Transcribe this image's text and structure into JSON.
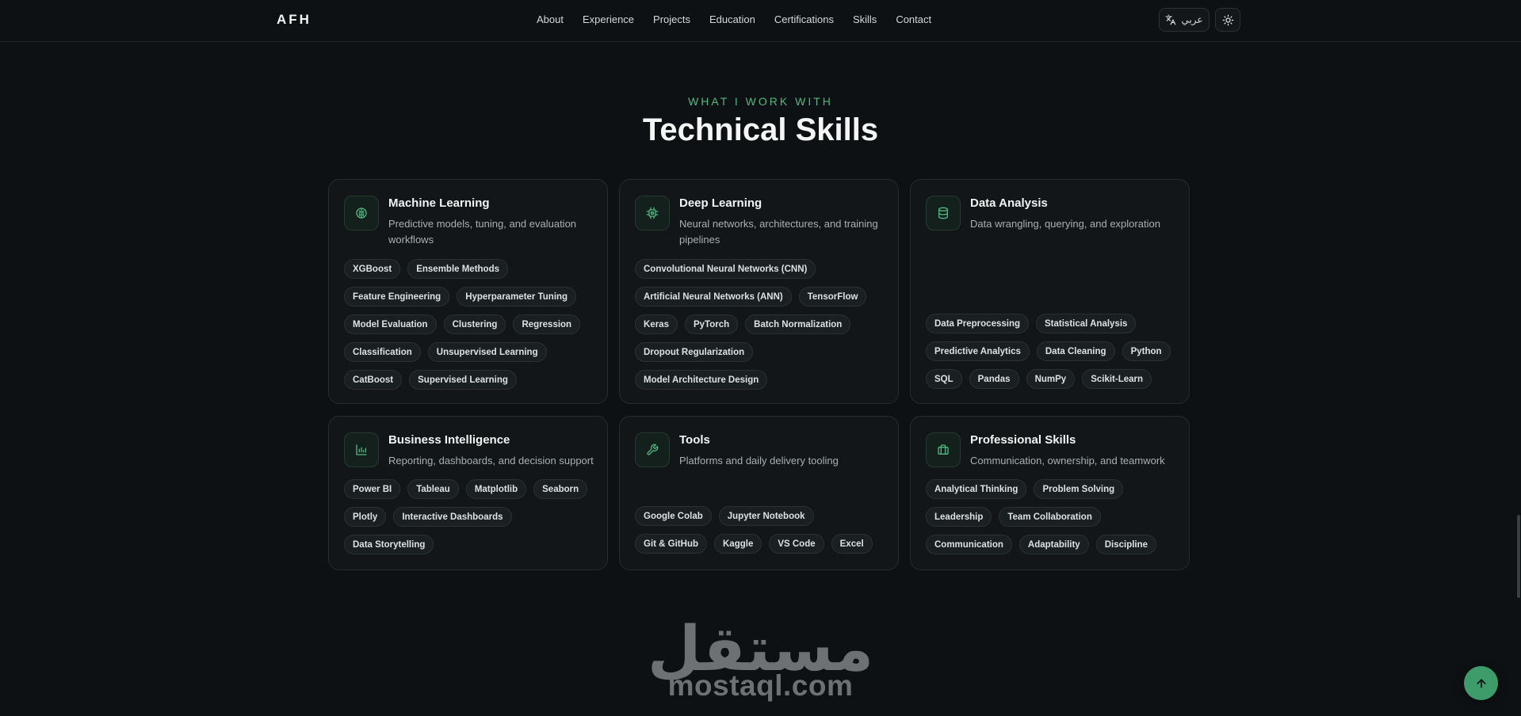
{
  "header": {
    "logo": "AFH",
    "nav": [
      "About",
      "Experience",
      "Projects",
      "Education",
      "Certifications",
      "Skills",
      "Contact"
    ],
    "lang_label": "عربي",
    "lang_icon": "translate-icon",
    "theme_icon": "sun-icon"
  },
  "section": {
    "eyebrow": "WHAT I WORK WITH",
    "title": "Technical Skills"
  },
  "cards": [
    {
      "icon": "brain-icon",
      "title": "Machine Learning",
      "description": "Predictive models, tuning, and evaluation workflows",
      "tags": [
        "XGBoost",
        "Ensemble Methods",
        "Feature Engineering",
        "Hyperparameter Tuning",
        "Model Evaluation",
        "Clustering",
        "Regression",
        "Classification",
        "Unsupervised Learning",
        "CatBoost",
        "Supervised Learning"
      ]
    },
    {
      "icon": "cpu-icon",
      "title": "Deep Learning",
      "description": "Neural networks, architectures, and training pipelines",
      "tags": [
        "Convolutional Neural Networks (CNN)",
        "Artificial Neural Networks (ANN)",
        "TensorFlow",
        "Keras",
        "PyTorch",
        "Batch Normalization",
        "Dropout Regularization",
        "Model Architecture Design"
      ]
    },
    {
      "icon": "database-icon",
      "title": "Data Analysis",
      "description": "Data wrangling, querying, and exploration",
      "tags": [
        "Data Preprocessing",
        "Statistical Analysis",
        "Predictive Analytics",
        "Data Cleaning",
        "Python",
        "SQL",
        "Pandas",
        "NumPy",
        "Scikit-Learn"
      ]
    },
    {
      "icon": "bar-chart-icon",
      "title": "Business Intelligence",
      "description": "Reporting, dashboards, and decision support",
      "tags": [
        "Power BI",
        "Tableau",
        "Matplotlib",
        "Seaborn",
        "Plotly",
        "Interactive Dashboards",
        "Data Storytelling"
      ]
    },
    {
      "icon": "wrench-icon",
      "title": "Tools",
      "description": "Platforms and daily delivery tooling",
      "tags": [
        "Google Colab",
        "Jupyter Notebook",
        "Git & GitHub",
        "Kaggle",
        "VS Code",
        "Excel"
      ]
    },
    {
      "icon": "briefcase-icon",
      "title": "Professional Skills",
      "description": "Communication, ownership, and teamwork",
      "tags": [
        "Analytical Thinking",
        "Problem Solving",
        "Leadership",
        "Team Collaboration",
        "Communication",
        "Adaptability",
        "Discipline"
      ]
    }
  ],
  "watermark": {
    "arabic": "مستقل",
    "latin": "mostaql.com"
  },
  "scroll_top_icon": "arrow-up-icon",
  "colors": {
    "accent": "#4fb882",
    "background": "#0e1113",
    "card": "#121618"
  }
}
